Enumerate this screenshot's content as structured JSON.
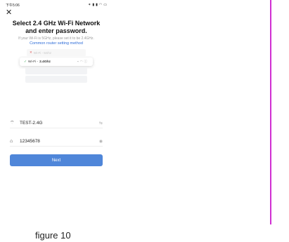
{
  "status_bar": {
    "time": "下午5:06",
    "icons": [
      "sim-icon",
      "signal-icon",
      "signal-icon",
      "wifi-icon",
      "battery-icon"
    ],
    "icon_glyphs": [
      "✶",
      "▮",
      "▮",
      "◠",
      "▭"
    ]
  },
  "page": {
    "title_line1": "Select 2.4 GHz Wi-Fi Network",
    "title_line2": "and enter password.",
    "hint": "If your Wi-Fi is 5GHz, please set it to be 2.4GHz.",
    "link": "Common router setting method"
  },
  "illustration": {
    "bad_label": "Wi-Fi - 5Ghz",
    "good_label_prefix": "Wi-Fi - ",
    "good_label_band": "2.4Ghz",
    "bad_mark": "✕",
    "good_mark": "✓"
  },
  "form": {
    "ssid": "TEST-2.4G",
    "password": "12345678",
    "wifi_glyph": "⌔",
    "lock_glyph": "⌂",
    "switch_glyph": "⇆",
    "eye_glyph": "◉"
  },
  "actions": {
    "next_label": "Next"
  },
  "caption": "figure 10",
  "colors": {
    "accent": "#4f86d9",
    "link": "#2e6cd8",
    "rule": "#d02fd2"
  }
}
